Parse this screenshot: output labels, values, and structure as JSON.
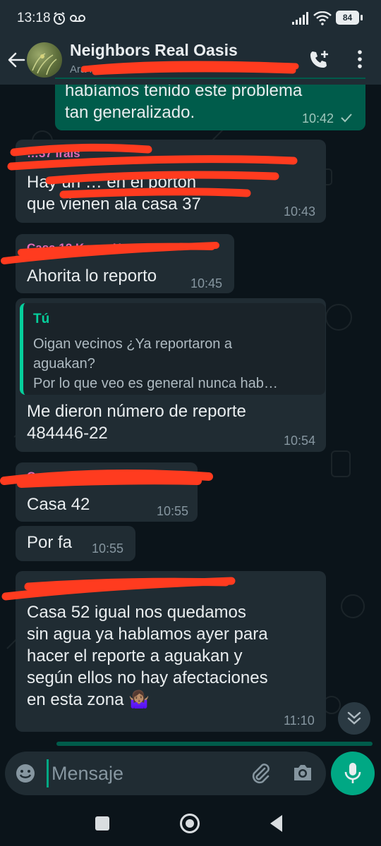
{
  "status_bar": {
    "time": "13:18",
    "battery": "84",
    "icons": [
      "alarm-icon",
      "voicemail-icon",
      "signal-icon",
      "wifi-icon",
      "battery-icon"
    ]
  },
  "header": {
    "title": "Neighbors Real Oasis",
    "subtitle": "Ara N",
    "icons": [
      "back-arrow-icon",
      "group-avatar",
      "add-call-icon",
      "more-vert-icon"
    ]
  },
  "messages": [
    {
      "id": "m0",
      "direction": "out",
      "text": "habíamos tenido este problema\ntan generalizado.",
      "time": "10:42",
      "status": "sent-check"
    },
    {
      "id": "m1",
      "direction": "in",
      "sender": "…37 Irais",
      "text": "Hay un … en el portón\nque vienen ala casa 37",
      "time": "10:43"
    },
    {
      "id": "m2",
      "direction": "in",
      "sender": "Casa 12 Karen Herrera",
      "text": "Ahorita lo reporto",
      "time": "10:45"
    },
    {
      "id": "m3",
      "direction": "in",
      "quote": {
        "sender": "Tú",
        "lines": [
          "Oigan vecinos ¿Ya reportaron a",
          "aguakan?",
          "Por lo que veo es general nunca hab…"
        ]
      },
      "text": "Me dieron número de reporte\n484446-22",
      "time": "10:54"
    },
    {
      "id": "m4",
      "direction": "in",
      "sender": "Casa 42 …",
      "text": "Casa 42",
      "time": "10:55"
    },
    {
      "id": "m5",
      "direction": "in",
      "text": "Por fa",
      "time": "10:55"
    },
    {
      "id": "m6",
      "direction": "in",
      "sender": "…",
      "text": "Casa 52 igual nos quedamos\nsin agua ya hablamos ayer para\nhacer el reporte a aguakan y\nsegún ellos no hay afectaciones\nen esta zona 🤷🏽‍♀️",
      "time": "11:10"
    }
  ],
  "composer": {
    "placeholder": "Mensaje",
    "icons": [
      "emoji-icon",
      "attach-icon",
      "camera-icon",
      "mic-icon"
    ]
  },
  "scroll_down_icon": "double-chevron-down-icon",
  "nav_bar": {
    "icons": [
      "recents-square-icon",
      "home-circle-icon",
      "back-triangle-icon"
    ]
  },
  "colors": {
    "background": "#0b141a",
    "incoming_bubble": "#202c33",
    "outgoing_bubble": "#005c4b",
    "accent": "#00a884",
    "redaction": "#ff3b1f"
  }
}
